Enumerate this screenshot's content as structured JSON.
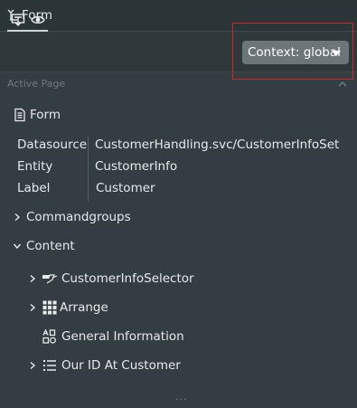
{
  "titlebar": {
    "title": "Form"
  },
  "toolbar": {
    "context_label": "Context: global"
  },
  "panel": {
    "section_title": "Active Page",
    "form_label": "Form",
    "properties": [
      {
        "key": "Datasource",
        "value": "CustomerHandling.svc/CustomerInfoSet"
      },
      {
        "key": "Entity",
        "value": "CustomerInfo"
      },
      {
        "key": "Label",
        "value": "Customer"
      }
    ],
    "tree": {
      "commandgroups": "Commandgroups",
      "content": "Content",
      "items": [
        "CustomerInfoSelector",
        "Arrange",
        "General Information",
        "Our ID At Customer"
      ]
    },
    "more": "..."
  }
}
